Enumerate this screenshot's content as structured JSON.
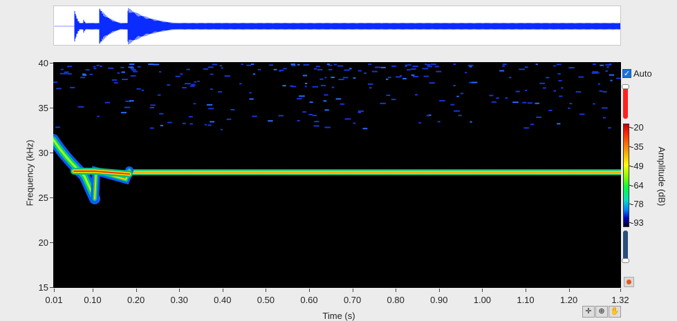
{
  "axes": {
    "y_label": "Frequency (kHz)",
    "y_ticks": [
      "40",
      "35",
      "30",
      "25",
      "20",
      "15"
    ],
    "x_label": "Time (s)",
    "x_ticks": [
      "0.01",
      "0.10",
      "0.20",
      "0.30",
      "0.40",
      "0.50",
      "0.60",
      "0.70",
      "0.80",
      "0.90",
      "1.00",
      "1.10",
      "1.20",
      "1.32"
    ]
  },
  "colorbar": {
    "label": "Amplitude (dB)",
    "ticks": [
      "-20",
      "-35",
      "-49",
      "-64",
      "-78",
      "-93"
    ]
  },
  "auto_scale": {
    "label": "Auto",
    "checked": true
  },
  "toolbar": {
    "cursor_icon": "crosshair-icon",
    "zoom_icon": "zoom-icon",
    "pan_icon": "hand-icon"
  },
  "colors": {
    "waveform": "#0a2cff",
    "plot_background": "#000000",
    "tone_band": "#ffd000"
  }
}
